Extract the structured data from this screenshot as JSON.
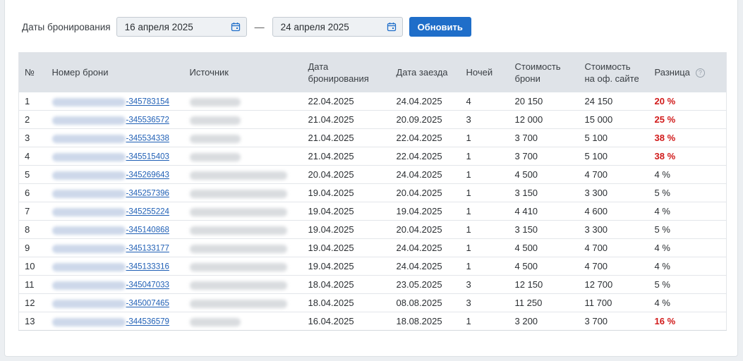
{
  "filters": {
    "label": "Даты бронирования",
    "date_from": "16 апреля 2025",
    "separator": "—",
    "date_to": "24 апреля 2025",
    "refresh_label": "Обновить"
  },
  "columns": [
    "№",
    "Номер брони",
    "Источник",
    "Дата бронирования",
    "Дата заезда",
    "Ночей",
    "Стоимость брони",
    "Стоимость на оф. сайте",
    "Разница"
  ],
  "rows": [
    {
      "n": "1",
      "booking": "-345783154",
      "booked": "22.04.2025",
      "checkin": "24.04.2025",
      "nights": "4",
      "price": "20 150",
      "site_price": "24 150",
      "diff": "20 %",
      "high": true
    },
    {
      "n": "2",
      "booking": "-345536572",
      "booked": "21.04.2025",
      "checkin": "20.09.2025",
      "nights": "3",
      "price": "12 000",
      "site_price": "15 000",
      "diff": "25 %",
      "high": true
    },
    {
      "n": "3",
      "booking": "-345534338",
      "booked": "21.04.2025",
      "checkin": "22.04.2025",
      "nights": "1",
      "price": "3 700",
      "site_price": "5 100",
      "diff": "38 %",
      "high": true
    },
    {
      "n": "4",
      "booking": "-345515403",
      "booked": "21.04.2025",
      "checkin": "22.04.2025",
      "nights": "1",
      "price": "3 700",
      "site_price": "5 100",
      "diff": "38 %",
      "high": true
    },
    {
      "n": "5",
      "booking": "-345269643",
      "booked": "20.04.2025",
      "checkin": "24.04.2025",
      "nights": "1",
      "price": "4 500",
      "site_price": "4 700",
      "diff": "4 %",
      "high": false
    },
    {
      "n": "6",
      "booking": "-345257396",
      "booked": "19.04.2025",
      "checkin": "20.04.2025",
      "nights": "1",
      "price": "3 150",
      "site_price": "3 300",
      "diff": "5 %",
      "high": false
    },
    {
      "n": "7",
      "booking": "-345255224",
      "booked": "19.04.2025",
      "checkin": "19.04.2025",
      "nights": "1",
      "price": "4 410",
      "site_price": "4 600",
      "diff": "4 %",
      "high": false
    },
    {
      "n": "8",
      "booking": "-345140868",
      "booked": "19.04.2025",
      "checkin": "20.04.2025",
      "nights": "1",
      "price": "3 150",
      "site_price": "3 300",
      "diff": "5 %",
      "high": false
    },
    {
      "n": "9",
      "booking": "-345133177",
      "booked": "19.04.2025",
      "checkin": "24.04.2025",
      "nights": "1",
      "price": "4 500",
      "site_price": "4 700",
      "diff": "4 %",
      "high": false
    },
    {
      "n": "10",
      "booking": "-345133316",
      "booked": "19.04.2025",
      "checkin": "24.04.2025",
      "nights": "1",
      "price": "4 500",
      "site_price": "4 700",
      "diff": "4 %",
      "high": false
    },
    {
      "n": "11",
      "booking": "-345047033",
      "booked": "18.04.2025",
      "checkin": "23.05.2025",
      "nights": "3",
      "price": "12 150",
      "site_price": "12 700",
      "diff": "5 %",
      "high": false
    },
    {
      "n": "12",
      "booking": "-345007465",
      "booked": "18.04.2025",
      "checkin": "08.08.2025",
      "nights": "3",
      "price": "11 250",
      "site_price": "11 700",
      "diff": "4 %",
      "high": false
    },
    {
      "n": "13",
      "booking": "-344536579",
      "booked": "16.04.2025",
      "checkin": "18.08.2025",
      "nights": "1",
      "price": "3 200",
      "site_price": "3 700",
      "diff": "16 %",
      "high": true
    }
  ],
  "colors": {
    "accent": "#1f6ec9",
    "highlight": "#d11a1a",
    "header_bg": "#dfe3e8"
  }
}
